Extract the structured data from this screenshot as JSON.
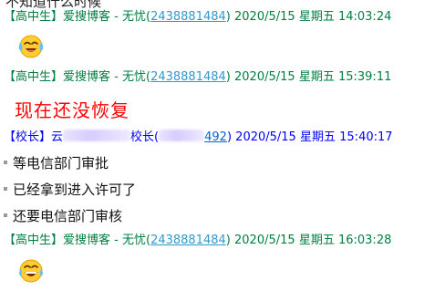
{
  "top_fragment": "不知道什么时候",
  "messages": [
    {
      "role": "【高中生】",
      "sender": "爱搜博客 - 无忧",
      "uid_open": "(",
      "uid": "2438881484",
      "uid_close": ")",
      "date": "2020/5/15",
      "weekday": "星期五",
      "time": "14:03:24",
      "emoji": "crying-laughing-emoji"
    },
    {
      "role": "【高中生】",
      "sender": "爱搜博客 - 无忧",
      "uid_open": "(",
      "uid": "2438881484",
      "uid_close": ")",
      "date": "2020/5/15",
      "weekday": "星期五",
      "time": "15:39:11",
      "text": "现在还没恢复"
    },
    {
      "role": "【校长】",
      "sender_prefix": "云",
      "sender_suffix": "校长",
      "uid_open": "(",
      "uid_tail": "492",
      "uid_close": ")",
      "date": "2020/5/15",
      "weekday": "星期五",
      "time": "15:40:17",
      "lines": [
        "等电信部门审批",
        "已经拿到进入许可了",
        "还要电信部门审核"
      ]
    },
    {
      "role": "【高中生】",
      "sender": "爱搜博客 - 无忧",
      "uid_open": "(",
      "uid": "2438881484",
      "uid_close": ")",
      "date": "2020/5/15",
      "weekday": "星期五",
      "time": "16:03:28",
      "emoji": "tears-of-joy-emoji"
    }
  ],
  "colors": {
    "student_header": "#008040",
    "principal_header": "#0000ff",
    "uid_link": "#3399cc",
    "highlight_text": "#ff0000"
  }
}
